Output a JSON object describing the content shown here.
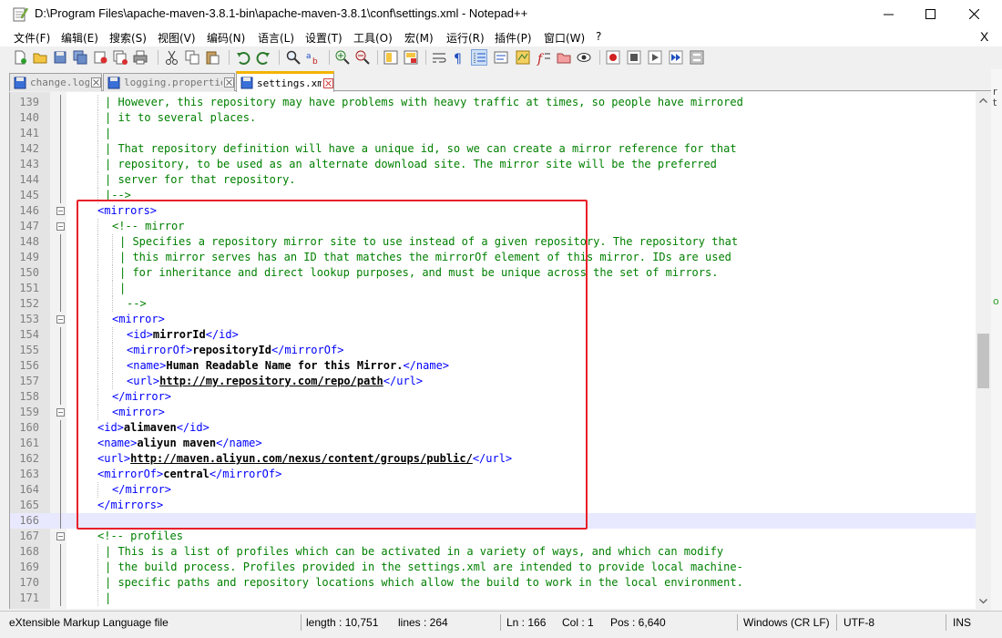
{
  "window": {
    "title": "D:\\Program Files\\apache-maven-3.8.1-bin\\apache-maven-3.8.1\\conf\\settings.xml - Notepad++",
    "icon": "notepad-plus-plus-icon"
  },
  "menu": {
    "items": [
      "文件(F)",
      "编辑(E)",
      "搜索(S)",
      "视图(V)",
      "编码(N)",
      "语言(L)",
      "设置(T)",
      "工具(O)",
      "宏(M)",
      "运行(R)",
      "插件(P)",
      "窗口(W)",
      "?"
    ],
    "close_glyph": "X"
  },
  "tabs": [
    {
      "label": "change.log",
      "active": false
    },
    {
      "label": "logging.properties",
      "active": false
    },
    {
      "label": "settings.xml",
      "active": true
    }
  ],
  "editor": {
    "current_line": 166,
    "lines": [
      {
        "n": 139,
        "indent": 3,
        "fold": "line",
        "segs": [
          [
            "c",
            "| However, this repository may have problems with heavy traffic at times, so people have mirrored"
          ]
        ]
      },
      {
        "n": 140,
        "indent": 3,
        "fold": "line",
        "segs": [
          [
            "c",
            "| it to several places."
          ]
        ]
      },
      {
        "n": 141,
        "indent": 3,
        "fold": "line",
        "segs": [
          [
            "c",
            "|"
          ]
        ]
      },
      {
        "n": 142,
        "indent": 3,
        "fold": "line",
        "segs": [
          [
            "c",
            "| That repository definition will have a unique id, so we can create a mirror reference for that"
          ]
        ]
      },
      {
        "n": 143,
        "indent": 3,
        "fold": "line",
        "segs": [
          [
            "c",
            "| repository, to be used as an alternate download site. The mirror site will be the preferred"
          ]
        ]
      },
      {
        "n": 144,
        "indent": 3,
        "fold": "line",
        "segs": [
          [
            "c",
            "| server for that repository."
          ]
        ]
      },
      {
        "n": 145,
        "indent": 3,
        "fold": "line",
        "segs": [
          [
            "c",
            "|-->"
          ]
        ]
      },
      {
        "n": 146,
        "indent": 2,
        "fold": "box",
        "segs": [
          [
            "t",
            "<mirrors>"
          ]
        ]
      },
      {
        "n": 147,
        "indent": 4,
        "fold": "box",
        "segs": [
          [
            "c",
            "<!-- mirror"
          ]
        ]
      },
      {
        "n": 148,
        "indent": 5,
        "fold": "line",
        "segs": [
          [
            "c",
            "| Specifies a repository mirror site to use instead of a given repository. The repository that"
          ]
        ]
      },
      {
        "n": 149,
        "indent": 5,
        "fold": "line",
        "segs": [
          [
            "c",
            "| this mirror serves has an ID that matches the mirrorOf element of this mirror. IDs are used"
          ]
        ]
      },
      {
        "n": 150,
        "indent": 5,
        "fold": "line",
        "segs": [
          [
            "c",
            "| for inheritance and direct lookup purposes, and must be unique across the set of mirrors."
          ]
        ]
      },
      {
        "n": 151,
        "indent": 5,
        "fold": "line",
        "segs": [
          [
            "c",
            "|"
          ]
        ]
      },
      {
        "n": 152,
        "indent": 6,
        "fold": "line",
        "segs": [
          [
            "c",
            "-->"
          ]
        ]
      },
      {
        "n": 153,
        "indent": 4,
        "fold": "box",
        "segs": [
          [
            "t",
            "<mirror>"
          ]
        ]
      },
      {
        "n": 154,
        "indent": 6,
        "fold": "line",
        "segs": [
          [
            "t",
            "<id>"
          ],
          [
            "x",
            "mirrorId"
          ],
          [
            "t",
            "</id>"
          ]
        ]
      },
      {
        "n": 155,
        "indent": 6,
        "fold": "line",
        "segs": [
          [
            "t",
            "<mirrorOf>"
          ],
          [
            "x",
            "repositoryId"
          ],
          [
            "t",
            "</mirrorOf>"
          ]
        ]
      },
      {
        "n": 156,
        "indent": 6,
        "fold": "line",
        "segs": [
          [
            "t",
            "<name>"
          ],
          [
            "x",
            "Human Readable Name for this Mirror."
          ],
          [
            "t",
            "</name>"
          ]
        ]
      },
      {
        "n": 157,
        "indent": 6,
        "fold": "line",
        "segs": [
          [
            "t",
            "<url>"
          ],
          [
            "u",
            "http://my.repository.com/repo/path"
          ],
          [
            "t",
            "</url>"
          ]
        ]
      },
      {
        "n": 158,
        "indent": 4,
        "fold": "line",
        "segs": [
          [
            "t",
            "</mirror>"
          ]
        ]
      },
      {
        "n": 159,
        "indent": 4,
        "fold": "box",
        "segs": [
          [
            "t",
            "<mirror>"
          ]
        ]
      },
      {
        "n": 160,
        "indent": 2,
        "fold": "line",
        "segs": [
          [
            "t",
            "<id>"
          ],
          [
            "x",
            "alimaven"
          ],
          [
            "t",
            "</id>"
          ]
        ]
      },
      {
        "n": 161,
        "indent": 2,
        "fold": "line",
        "segs": [
          [
            "t",
            "<name>"
          ],
          [
            "x",
            "aliyun maven"
          ],
          [
            "t",
            "</name>"
          ]
        ]
      },
      {
        "n": 162,
        "indent": 2,
        "fold": "line",
        "segs": [
          [
            "t",
            "<url>"
          ],
          [
            "u",
            "http://maven.aliyun.com/nexus/content/groups/public/"
          ],
          [
            "t",
            "</url>"
          ]
        ]
      },
      {
        "n": 163,
        "indent": 2,
        "fold": "line",
        "segs": [
          [
            "t",
            "<mirrorOf>"
          ],
          [
            "x",
            "central"
          ],
          [
            "t",
            "</mirrorOf>"
          ]
        ]
      },
      {
        "n": 164,
        "indent": 4,
        "fold": "line",
        "segs": [
          [
            "t",
            "</mirror>"
          ]
        ]
      },
      {
        "n": 165,
        "indent": 2,
        "fold": "line",
        "segs": [
          [
            "t",
            "</mirrors>"
          ]
        ]
      },
      {
        "n": 166,
        "indent": 0,
        "fold": "line",
        "segs": []
      },
      {
        "n": 167,
        "indent": 2,
        "fold": "box",
        "segs": [
          [
            "c",
            "<!-- profiles"
          ]
        ]
      },
      {
        "n": 168,
        "indent": 3,
        "fold": "line",
        "segs": [
          [
            "c",
            "| This is a list of profiles which can be activated in a variety of ways, and which can modify"
          ]
        ]
      },
      {
        "n": 169,
        "indent": 3,
        "fold": "line",
        "segs": [
          [
            "c",
            "| the build process. Profiles provided in the settings.xml are intended to provide local machine-"
          ]
        ]
      },
      {
        "n": 170,
        "indent": 3,
        "fold": "line",
        "segs": [
          [
            "c",
            "| specific paths and repository locations which allow the build to work in the local environment."
          ]
        ]
      },
      {
        "n": 171,
        "indent": 3,
        "fold": "line",
        "segs": [
          [
            "c",
            "|"
          ]
        ]
      }
    ]
  },
  "statusbar": {
    "language": "eXtensible Markup Language file",
    "length": "length : 10,751",
    "lines": "lines : 264",
    "ln": "Ln : 166",
    "col": "Col : 1",
    "pos": "Pos : 6,640",
    "eol": "Windows (CR LF)",
    "encoding": "UTF-8",
    "mode": "INS"
  },
  "colors": {
    "comment": "#008000",
    "tag": "#0000ff",
    "highlight_box": "#e8202a",
    "active_tab_accent": "#f4b400"
  }
}
